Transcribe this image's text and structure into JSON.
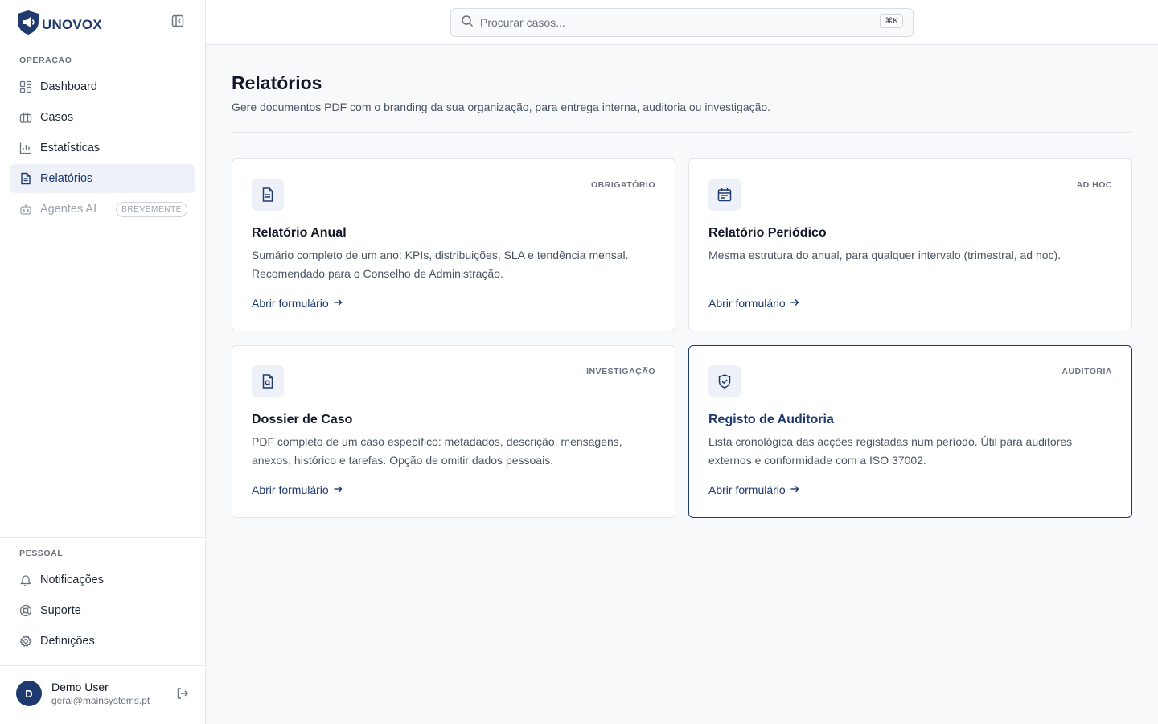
{
  "app": {
    "logo_text": "UNOVOX",
    "brand_color": "#1e3a6e"
  },
  "sidebar": {
    "sections": {
      "operation": "OPERAÇÃO",
      "personal": "PESSOAL"
    },
    "items": [
      {
        "label": "Dashboard",
        "icon": "grid-icon"
      },
      {
        "label": "Casos",
        "icon": "briefcase-icon"
      },
      {
        "label": "Estatísticas",
        "icon": "bar-chart-icon"
      },
      {
        "label": "Relatórios",
        "icon": "file-text-icon",
        "active": true
      },
      {
        "label": "Agentes AI",
        "icon": "bot-icon",
        "badge": "BREVEMENTE",
        "disabled": true
      }
    ],
    "personal_items": [
      {
        "label": "Notificações",
        "icon": "bell-icon"
      },
      {
        "label": "Suporte",
        "icon": "life-buoy-icon"
      },
      {
        "label": "Definições",
        "icon": "gear-icon"
      }
    ],
    "user": {
      "initial": "D",
      "name": "Demo User",
      "email": "geral@mainsystems.pt"
    }
  },
  "topbar": {
    "search_placeholder": "Procurar casos...",
    "shortcut": "⌘K"
  },
  "main": {
    "title": "Relatórios",
    "subtitle": "Gere documentos PDF com o branding da sua organização, para entrega interna, auditoria ou investigação.",
    "cards": [
      {
        "tag": "OBRIGATÓRIO",
        "title": "Relatório Anual",
        "description": "Sumário completo de um ano: KPIs, distribuições, SLA e tendência mensal. Recomendado para o Conselho de Administração.",
        "link": "Abrir formulário",
        "icon": "file-text-icon"
      },
      {
        "tag": "AD HOC",
        "title": "Relatório Periódico",
        "description": "Mesma estrutura do anual, para qualquer intervalo (trimestral, ad hoc).",
        "link": "Abrir formulário",
        "icon": "calendar-icon"
      },
      {
        "tag": "INVESTIGAÇÃO",
        "title": "Dossier de Caso",
        "description": "PDF completo de um caso específico: metadados, descrição, mensagens, anexos, histórico e tarefas. Opção de omitir dados pessoais.",
        "link": "Abrir formulário",
        "icon": "file-search-icon"
      },
      {
        "tag": "AUDITORIA",
        "title": "Registo de Auditoria",
        "description": "Lista cronológica das acções registadas num período. Útil para auditores externos e conformidade com a ISO 37002.",
        "link": "Abrir formulário",
        "icon": "shield-check-icon",
        "selected": true
      }
    ]
  }
}
